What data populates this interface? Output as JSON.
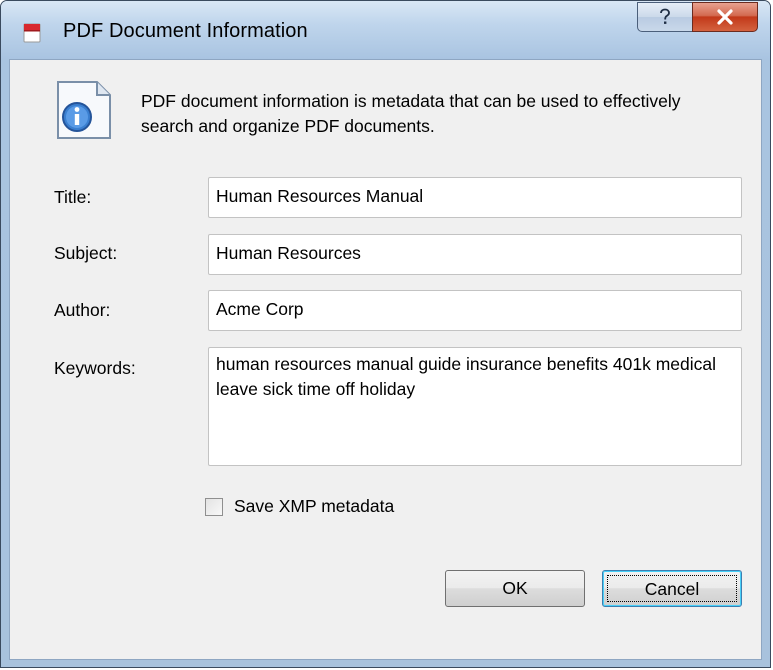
{
  "window": {
    "title": "PDF Document Information",
    "help_icon": "help-question-icon",
    "close_icon": "close-x-icon",
    "app_icon": "pdf-document-icon"
  },
  "info": {
    "icon": "info-document-icon",
    "text": "PDF document information is metadata that can be used to effectively search and organize PDF documents."
  },
  "fields": {
    "title_label": "Title:",
    "title_value": "Human Resources Manual",
    "subject_label": "Subject:",
    "subject_value": "Human Resources",
    "author_label": "Author:",
    "author_value": "Acme Corp",
    "keywords_label": "Keywords:",
    "keywords_value": "human resources manual guide insurance benefits 401k medical leave sick time off holiday"
  },
  "options": {
    "save_xmp_label": "Save XMP metadata",
    "save_xmp_checked": false
  },
  "buttons": {
    "ok_label": "OK",
    "cancel_label": "Cancel"
  },
  "colors": {
    "title_bar": "#bfd5ec",
    "close_button": "#c2391a",
    "dialog_background": "#f0f0f0",
    "focus_accent": "#48d0f8"
  }
}
